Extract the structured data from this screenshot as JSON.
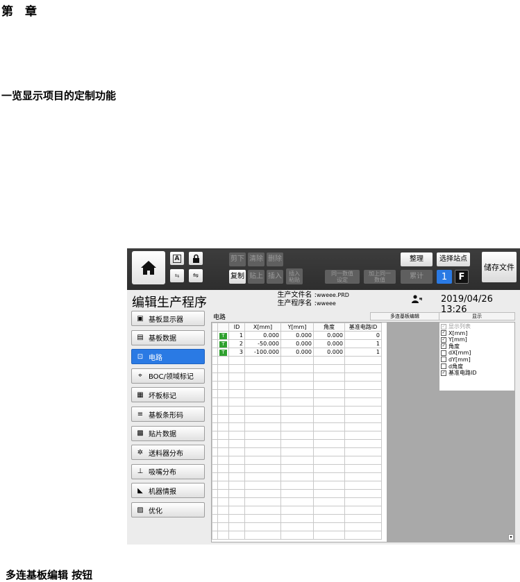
{
  "doc": {
    "chapter": "第　章",
    "section": "一览显示项目的定制功能",
    "caption": "多连基板编辑 按钮"
  },
  "toolbar": {
    "row1": [
      "剪下",
      "清除",
      "删除"
    ],
    "row2_copy": "复制",
    "row2_paste": "贴上",
    "row2_insert": "插入",
    "row2_insert_paste": [
      "插入",
      "粘贴"
    ],
    "same_value": [
      "同一数值",
      "设定"
    ],
    "add_same": [
      "加上同一",
      "数值"
    ],
    "arrange": "整理",
    "accumulate": "累计",
    "select_station": "选择站点",
    "station_number": "1",
    "station_letter": "F",
    "save_file": "储存文件",
    "small_icon_a": "A",
    "small_icon_lock": "lock-icon"
  },
  "header": {
    "page_title": "编辑生产程序",
    "prod_file_label": "生产文件名 :",
    "prod_file_value": "wweee.PRD",
    "prod_program_label": "生产程序名 :",
    "prod_program_value": "wweee",
    "datetime": "2019/04/26 13:26"
  },
  "sidebar": {
    "items": [
      {
        "label": "基板显示器",
        "icon": "board-display-icon",
        "active": false
      },
      {
        "label": "基板数据",
        "icon": "board-data-icon",
        "active": false
      },
      {
        "label": "电路",
        "icon": "circuit-icon",
        "active": true
      },
      {
        "label": "BOC/领域标记",
        "icon": "boc-mark-icon",
        "active": false
      },
      {
        "label": "坏板标记",
        "icon": "bad-board-icon",
        "active": false
      },
      {
        "label": "基板条形码",
        "icon": "barcode-icon",
        "active": false
      },
      {
        "label": "贴片数据",
        "icon": "placement-data-icon",
        "active": false
      },
      {
        "label": "送料器分布",
        "icon": "feeder-icon",
        "active": false
      },
      {
        "label": "吸嘴分布",
        "icon": "nozzle-icon",
        "active": false
      },
      {
        "label": "机器情报",
        "icon": "machine-info-icon",
        "active": false
      },
      {
        "label": "优化",
        "icon": "optimize-icon",
        "active": false
      }
    ]
  },
  "panel": {
    "label": "电路",
    "multi_edit": "多连基板编辑",
    "display_button": "显示",
    "columns": [
      "ID",
      "X[mm]",
      "Y[mm]",
      "角度",
      "基准电路ID"
    ],
    "rows": [
      {
        "tag": "T",
        "id": "1",
        "x": "0.000",
        "y": "0.000",
        "angle": "0.000",
        "ref": "0"
      },
      {
        "tag": "T",
        "id": "2",
        "x": "-50.000",
        "y": "0.000",
        "angle": "0.000",
        "ref": "1"
      },
      {
        "tag": "T",
        "id": "3",
        "x": "-100.000",
        "y": "0.000",
        "angle": "0.000",
        "ref": "1"
      }
    ],
    "display_items": [
      {
        "label": "显示列表",
        "checked": true,
        "disabled": true
      },
      {
        "label": "X[mm]",
        "checked": true,
        "disabled": false
      },
      {
        "label": "Y[mm]",
        "checked": true,
        "disabled": false
      },
      {
        "label": "角度",
        "checked": true,
        "disabled": false
      },
      {
        "label": "dX[mm]",
        "checked": false,
        "disabled": false
      },
      {
        "label": "dY[mm]",
        "checked": false,
        "disabled": false
      },
      {
        "label": "d角度",
        "checked": false,
        "disabled": false
      },
      {
        "label": "基准电路ID",
        "checked": true,
        "disabled": false
      }
    ]
  }
}
